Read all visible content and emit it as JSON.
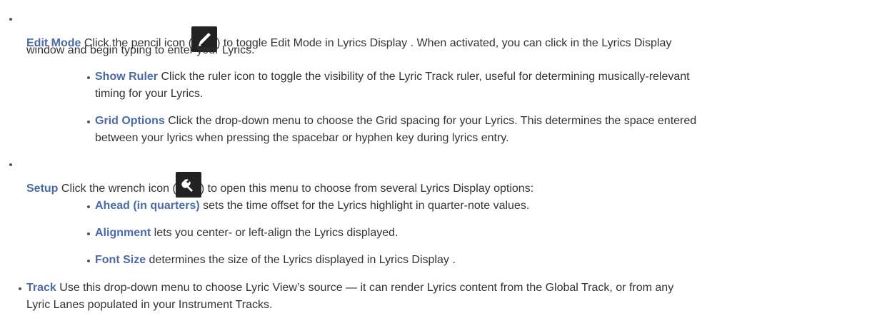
{
  "items": {
    "edit_mode": {
      "term": "Edit Mode",
      "text_before_icon": " Click the pencil icon (",
      "icon": "pencil-icon",
      "text_after_icon": ") to toggle Edit Mode in Lyrics Display . When activated, you can click in the Lyrics Display",
      "text_line2": "window and begin typing to enter your Lyrics.",
      "subitems": [
        {
          "term": "Show Ruler",
          "text_line1": " Click the ruler icon to toggle the visibility of the Lyric Track ruler, useful for determining musically-relevant",
          "text_line2": "timing for your Lyrics."
        },
        {
          "term": "Grid Options",
          "text_line1": " Click the drop-down menu to choose the Grid spacing for your Lyrics. This determines the space entered",
          "text_line2": "between your lyrics when pressing the spacebar or hyphen key during lyrics entry."
        }
      ]
    },
    "setup": {
      "term": "Setup",
      "text_before_icon": " Click the wrench icon (",
      "icon": "wrench-icon",
      "text_after_icon": ") to open this menu to choose from several Lyrics Display options:",
      "subitems": [
        {
          "term": "Ahead (in quarters)",
          "text": " sets the time offset for the Lyrics highlight in quarter-note values."
        },
        {
          "term": "Alignment",
          "text": " lets you center- or left-align the Lyrics displayed."
        },
        {
          "term": "Font Size",
          "text": " determines the size of the Lyrics displayed in Lyrics Display ."
        }
      ]
    },
    "track": {
      "term": "Track",
      "text_line1": " Use this drop-down menu to choose Lyric View’s source — it can render Lyrics content from the Global Track, or from any",
      "text_line2": "Lyric Lanes populated in your Instrument Tracks."
    }
  },
  "colors": {
    "term": "#4a6aa8",
    "body_text": "#333333",
    "icon_bg": "#222222"
  }
}
